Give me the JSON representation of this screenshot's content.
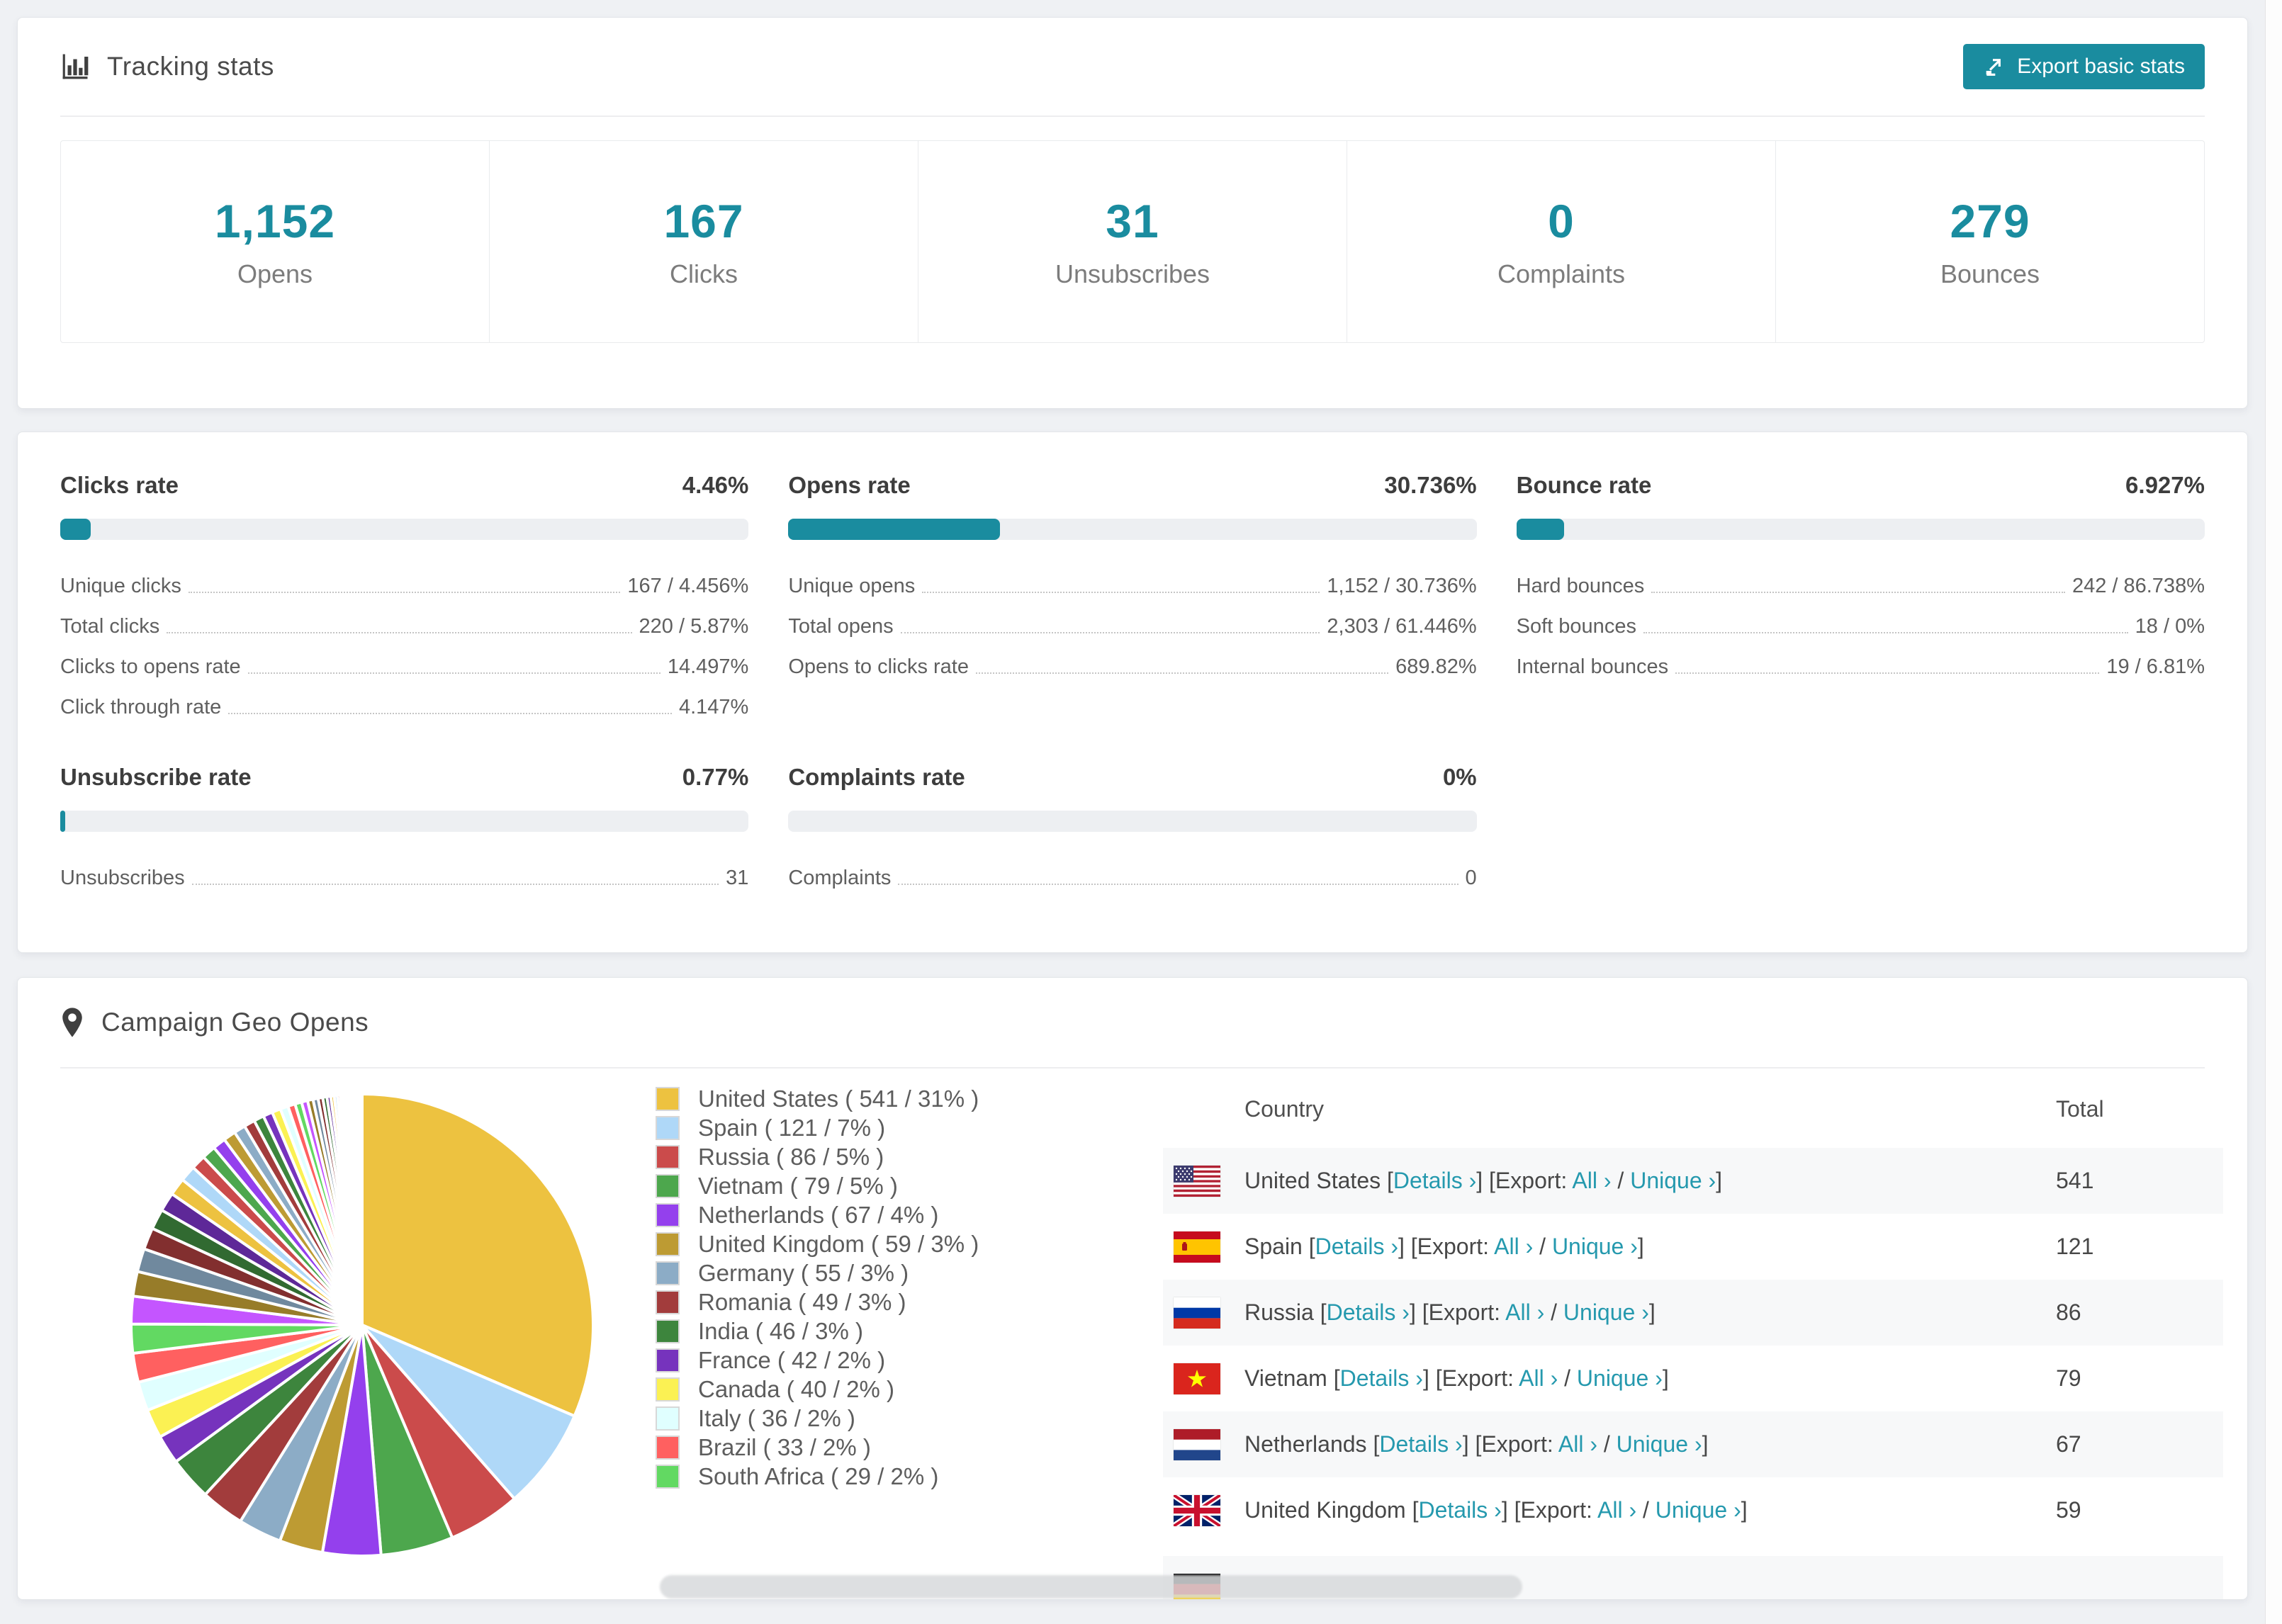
{
  "page": {
    "background": "#eff1f4",
    "accent": "#1a8c9f",
    "link_color": "#2599ae"
  },
  "tracking": {
    "title": "Tracking stats",
    "export_button": "Export basic stats",
    "stats": [
      {
        "value": "1,152",
        "label": "Opens"
      },
      {
        "value": "167",
        "label": "Clicks"
      },
      {
        "value": "31",
        "label": "Unsubscribes"
      },
      {
        "value": "0",
        "label": "Complaints"
      },
      {
        "value": "279",
        "label": "Bounces"
      }
    ]
  },
  "rates": {
    "clicks": {
      "title": "Clicks rate",
      "display": "4.46%",
      "percent": 4.46,
      "rows": [
        {
          "label": "Unique clicks",
          "value": "167 / 4.456%"
        },
        {
          "label": "Total clicks",
          "value": "220 / 5.87%"
        },
        {
          "label": "Clicks to opens rate",
          "value": "14.497%"
        },
        {
          "label": "Click through rate",
          "value": "4.147%"
        }
      ]
    },
    "opens": {
      "title": "Opens rate",
      "display": "30.736%",
      "percent": 30.736,
      "rows": [
        {
          "label": "Unique opens",
          "value": "1,152 / 30.736%"
        },
        {
          "label": "Total opens",
          "value": "2,303 / 61.446%"
        },
        {
          "label": "Opens to clicks rate",
          "value": "689.82%"
        }
      ]
    },
    "bounce": {
      "title": "Bounce rate",
      "display": "6.927%",
      "percent": 6.927,
      "rows": [
        {
          "label": "Hard bounces",
          "value": "242 / 86.738%"
        },
        {
          "label": "Soft bounces",
          "value": "18 / 0%"
        },
        {
          "label": "Internal bounces",
          "value": "19 / 6.81%"
        }
      ]
    },
    "unsubscribe": {
      "title": "Unsubscribe rate",
      "display": "0.77%",
      "percent": 0.77,
      "rows": [
        {
          "label": "Unsubscribes",
          "value": "31"
        }
      ]
    },
    "complaints": {
      "title": "Complaints rate",
      "display": "0%",
      "percent": 0,
      "rows": [
        {
          "label": "Complaints",
          "value": "0"
        }
      ]
    }
  },
  "geo": {
    "title": "Campaign Geo Opens",
    "chart_data": {
      "type": "pie",
      "title": "Campaign Geo Opens",
      "legend_position": "right",
      "start_angle_deg": -90,
      "direction": "clockwise",
      "slices": [
        {
          "label": "United States",
          "count": 541,
          "pct": 31,
          "color": "#EDC240"
        },
        {
          "label": "Spain",
          "count": 121,
          "pct": 7,
          "color": "#AFD8F8"
        },
        {
          "label": "Russia",
          "count": 86,
          "pct": 5,
          "color": "#CB4B4B"
        },
        {
          "label": "Vietnam",
          "count": 79,
          "pct": 5,
          "color": "#4DA74D"
        },
        {
          "label": "Netherlands",
          "count": 67,
          "pct": 4,
          "color": "#9440ED"
        },
        {
          "label": "United Kingdom",
          "count": 59,
          "pct": 3,
          "color": "#BD9B33"
        },
        {
          "label": "Germany",
          "count": 55,
          "pct": 3,
          "color": "#8CACC6"
        },
        {
          "label": "Romania",
          "count": 49,
          "pct": 3,
          "color": "#A23C3C"
        },
        {
          "label": "India",
          "count": 46,
          "pct": 3,
          "color": "#3D853D"
        },
        {
          "label": "France",
          "count": 42,
          "pct": 2,
          "color": "#7633BD"
        },
        {
          "label": "Canada",
          "count": 40,
          "pct": 2,
          "color": "#FBF153"
        },
        {
          "label": "Italy",
          "count": 36,
          "pct": 2,
          "color": "#E0FFFF"
        },
        {
          "label": "Brazil",
          "count": 33,
          "pct": 2,
          "color": "#FF6060"
        },
        {
          "label": "South Africa",
          "count": 29,
          "pct": 2,
          "color": "#62D962"
        }
      ],
      "other_slices_pct": [
        1.9,
        1.7,
        1.6,
        1.5,
        1.4,
        1.3,
        1.2,
        1.1,
        1.0,
        0.95,
        0.9,
        0.85,
        0.8,
        0.75,
        0.7,
        0.65,
        0.6,
        0.55,
        0.5,
        0.46,
        0.42,
        0.38,
        0.35,
        0.32,
        0.29,
        0.26,
        0.24,
        0.22,
        0.2,
        0.18,
        0.16,
        0.14,
        0.12,
        0.11,
        0.1,
        0.09,
        0.08,
        0.07,
        0.06,
        0.055,
        0.05,
        0.045,
        0.04,
        0.035,
        0.03,
        0.028,
        0.026,
        0.024,
        0.022,
        0.02
      ],
      "palette": [
        "#EDC240",
        "#AFD8F8",
        "#CB4B4B",
        "#4DA74D",
        "#9440ED",
        "#BD9B33",
        "#8CACC6",
        "#A23C3C",
        "#3D853D",
        "#7633BD",
        "#FBF153",
        "#E0FFFF",
        "#FF6060",
        "#62D962",
        "#C455FF",
        "#977C29",
        "#70899E",
        "#822F2F",
        "#316A31",
        "#5E2898"
      ]
    },
    "legend_format": {
      "open": " ( ",
      "sep": " / ",
      "close": "% )"
    },
    "table": {
      "headers": [
        "Country",
        "Total"
      ],
      "link_labels": {
        "details": "Details ›",
        "export_prefix": "[Export: ",
        "all": "All ›",
        "slash": " / ",
        "unique": "Unique ›",
        "open_bracket": " [",
        "close_bracket": "]"
      },
      "rows": [
        {
          "country": "United States",
          "flag": "us",
          "total": "541"
        },
        {
          "country": "Spain",
          "flag": "es",
          "total": "121"
        },
        {
          "country": "Russia",
          "flag": "ru",
          "total": "86"
        },
        {
          "country": "Vietnam",
          "flag": "vn",
          "total": "79"
        },
        {
          "country": "Netherlands",
          "flag": "nl",
          "total": "67"
        },
        {
          "country": "United Kingdom",
          "flag": "gb",
          "total": "59"
        }
      ],
      "partial_row": {
        "flag": "de"
      }
    }
  }
}
